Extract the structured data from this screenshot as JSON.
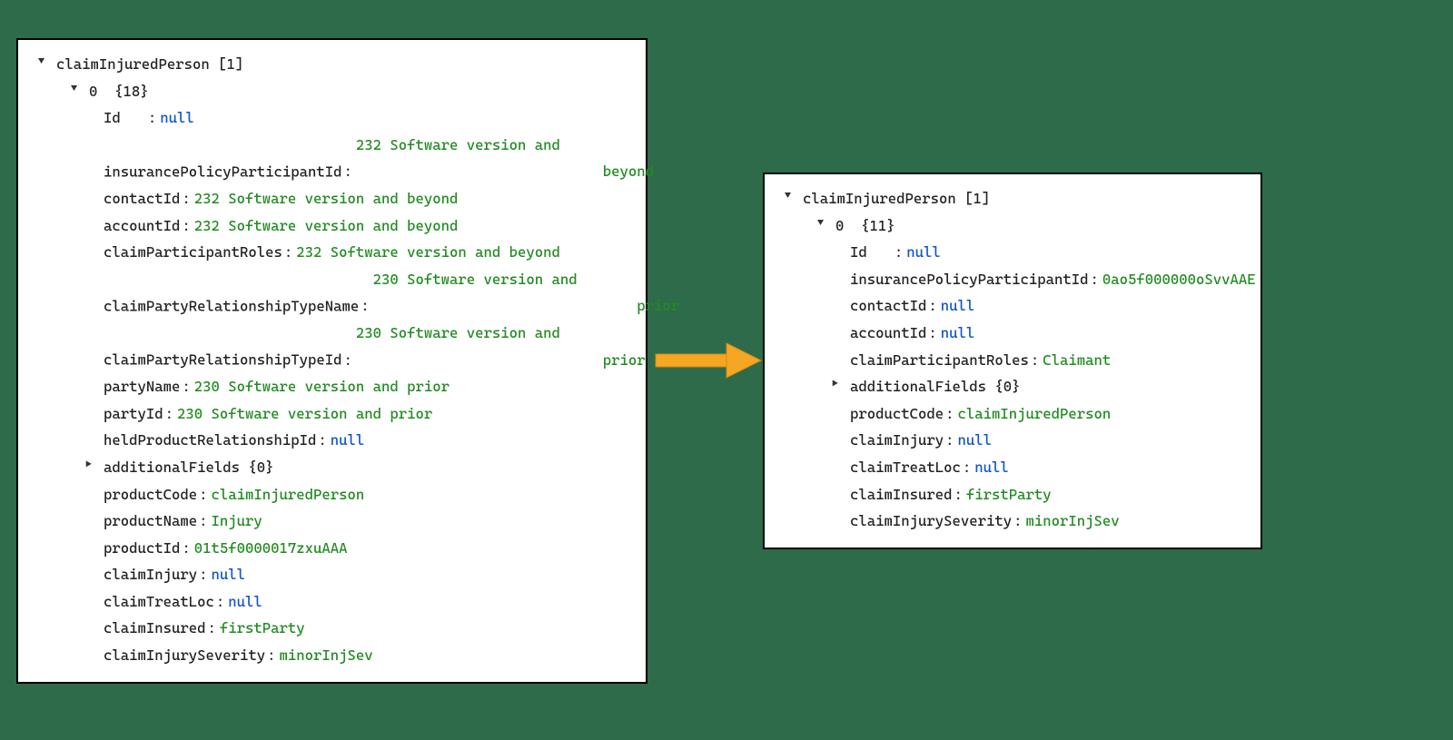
{
  "left": {
    "rootKey": "claimInjuredPerson",
    "rootSuffix": "[1]",
    "indexLabel": "0",
    "indexSuffix": "{18}",
    "entries": [
      {
        "toggle": null,
        "key": "Id",
        "keyPad": "   ",
        "value": "null",
        "vtype": "null"
      },
      {
        "toggle": null,
        "key": "insurancePolicyParticipantId",
        "value": "232 Software version and",
        "value2Pad": "                             ",
        "value2": "beyond",
        "vtype": "str-multi"
      },
      {
        "toggle": null,
        "key": "contactId",
        "value": "232 Software version and beyond",
        "vtype": "str"
      },
      {
        "toggle": null,
        "key": "accountId",
        "value": "232 Software version and beyond",
        "vtype": "str"
      },
      {
        "toggle": null,
        "key": "claimParticipantRoles",
        "value": "232 Software version and beyond",
        "vtype": "str"
      },
      {
        "toggle": null,
        "key": "claimPartyRelationshipTypeName",
        "value": "230 Software version and",
        "value2Pad": "                               ",
        "value2": "prior",
        "vtype": "str-multi"
      },
      {
        "toggle": null,
        "key": "claimPartyRelationshipTypeId",
        "value": "230 Software version and",
        "value2Pad": "                             ",
        "value2": "prior",
        "vtype": "str-multi"
      },
      {
        "toggle": null,
        "key": "partyName",
        "value": "230 Software version and prior",
        "vtype": "str"
      },
      {
        "toggle": null,
        "key": "partyId",
        "value": "230 Software version and prior",
        "vtype": "str"
      },
      {
        "toggle": null,
        "key": "heldProductRelationshipId",
        "value": "null",
        "vtype": "null"
      },
      {
        "toggle": "right",
        "key": "additionalFields",
        "suffix": "{0}",
        "vtype": "obj"
      },
      {
        "toggle": null,
        "key": "productCode",
        "value": "claimInjuredPerson",
        "vtype": "str"
      },
      {
        "toggle": null,
        "key": "productName",
        "value": "Injury",
        "vtype": "str"
      },
      {
        "toggle": null,
        "key": "productId",
        "value": "01t5f0000017zxuAAA",
        "vtype": "str"
      },
      {
        "toggle": null,
        "key": "claimInjury",
        "value": "null",
        "vtype": "null"
      },
      {
        "toggle": null,
        "key": "claimTreatLoc",
        "value": "null",
        "vtype": "null"
      },
      {
        "toggle": null,
        "key": "claimInsured",
        "value": "firstParty",
        "vtype": "str"
      },
      {
        "toggle": null,
        "key": "claimInjurySeverity",
        "value": "minorInjSev",
        "vtype": "str"
      }
    ]
  },
  "right": {
    "rootKey": "claimInjuredPerson",
    "rootSuffix": "[1]",
    "indexLabel": "0",
    "indexSuffix": "{11}",
    "entries": [
      {
        "toggle": null,
        "key": "Id",
        "keyPad": "   ",
        "value": "null",
        "vtype": "null"
      },
      {
        "toggle": null,
        "key": "insurancePolicyParticipantId",
        "value": "0ao5f000000oSvvAAE",
        "vtype": "str"
      },
      {
        "toggle": null,
        "key": "contactId",
        "value": "null",
        "vtype": "null"
      },
      {
        "toggle": null,
        "key": "accountId",
        "value": "null",
        "vtype": "null"
      },
      {
        "toggle": null,
        "key": "claimParticipantRoles",
        "value": "Claimant",
        "vtype": "str"
      },
      {
        "toggle": "right",
        "key": "additionalFields",
        "suffix": "{0}",
        "vtype": "obj"
      },
      {
        "toggle": null,
        "key": "productCode",
        "value": "claimInjuredPerson",
        "vtype": "str"
      },
      {
        "toggle": null,
        "key": "claimInjury",
        "value": "null",
        "vtype": "null"
      },
      {
        "toggle": null,
        "key": "claimTreatLoc",
        "value": "null",
        "vtype": "null"
      },
      {
        "toggle": null,
        "key": "claimInsured",
        "value": "firstParty",
        "vtype": "str"
      },
      {
        "toggle": null,
        "key": "claimInjurySeverity",
        "value": "minorInjSev",
        "vtype": "str"
      }
    ]
  },
  "arrowColor": "#f5a623"
}
